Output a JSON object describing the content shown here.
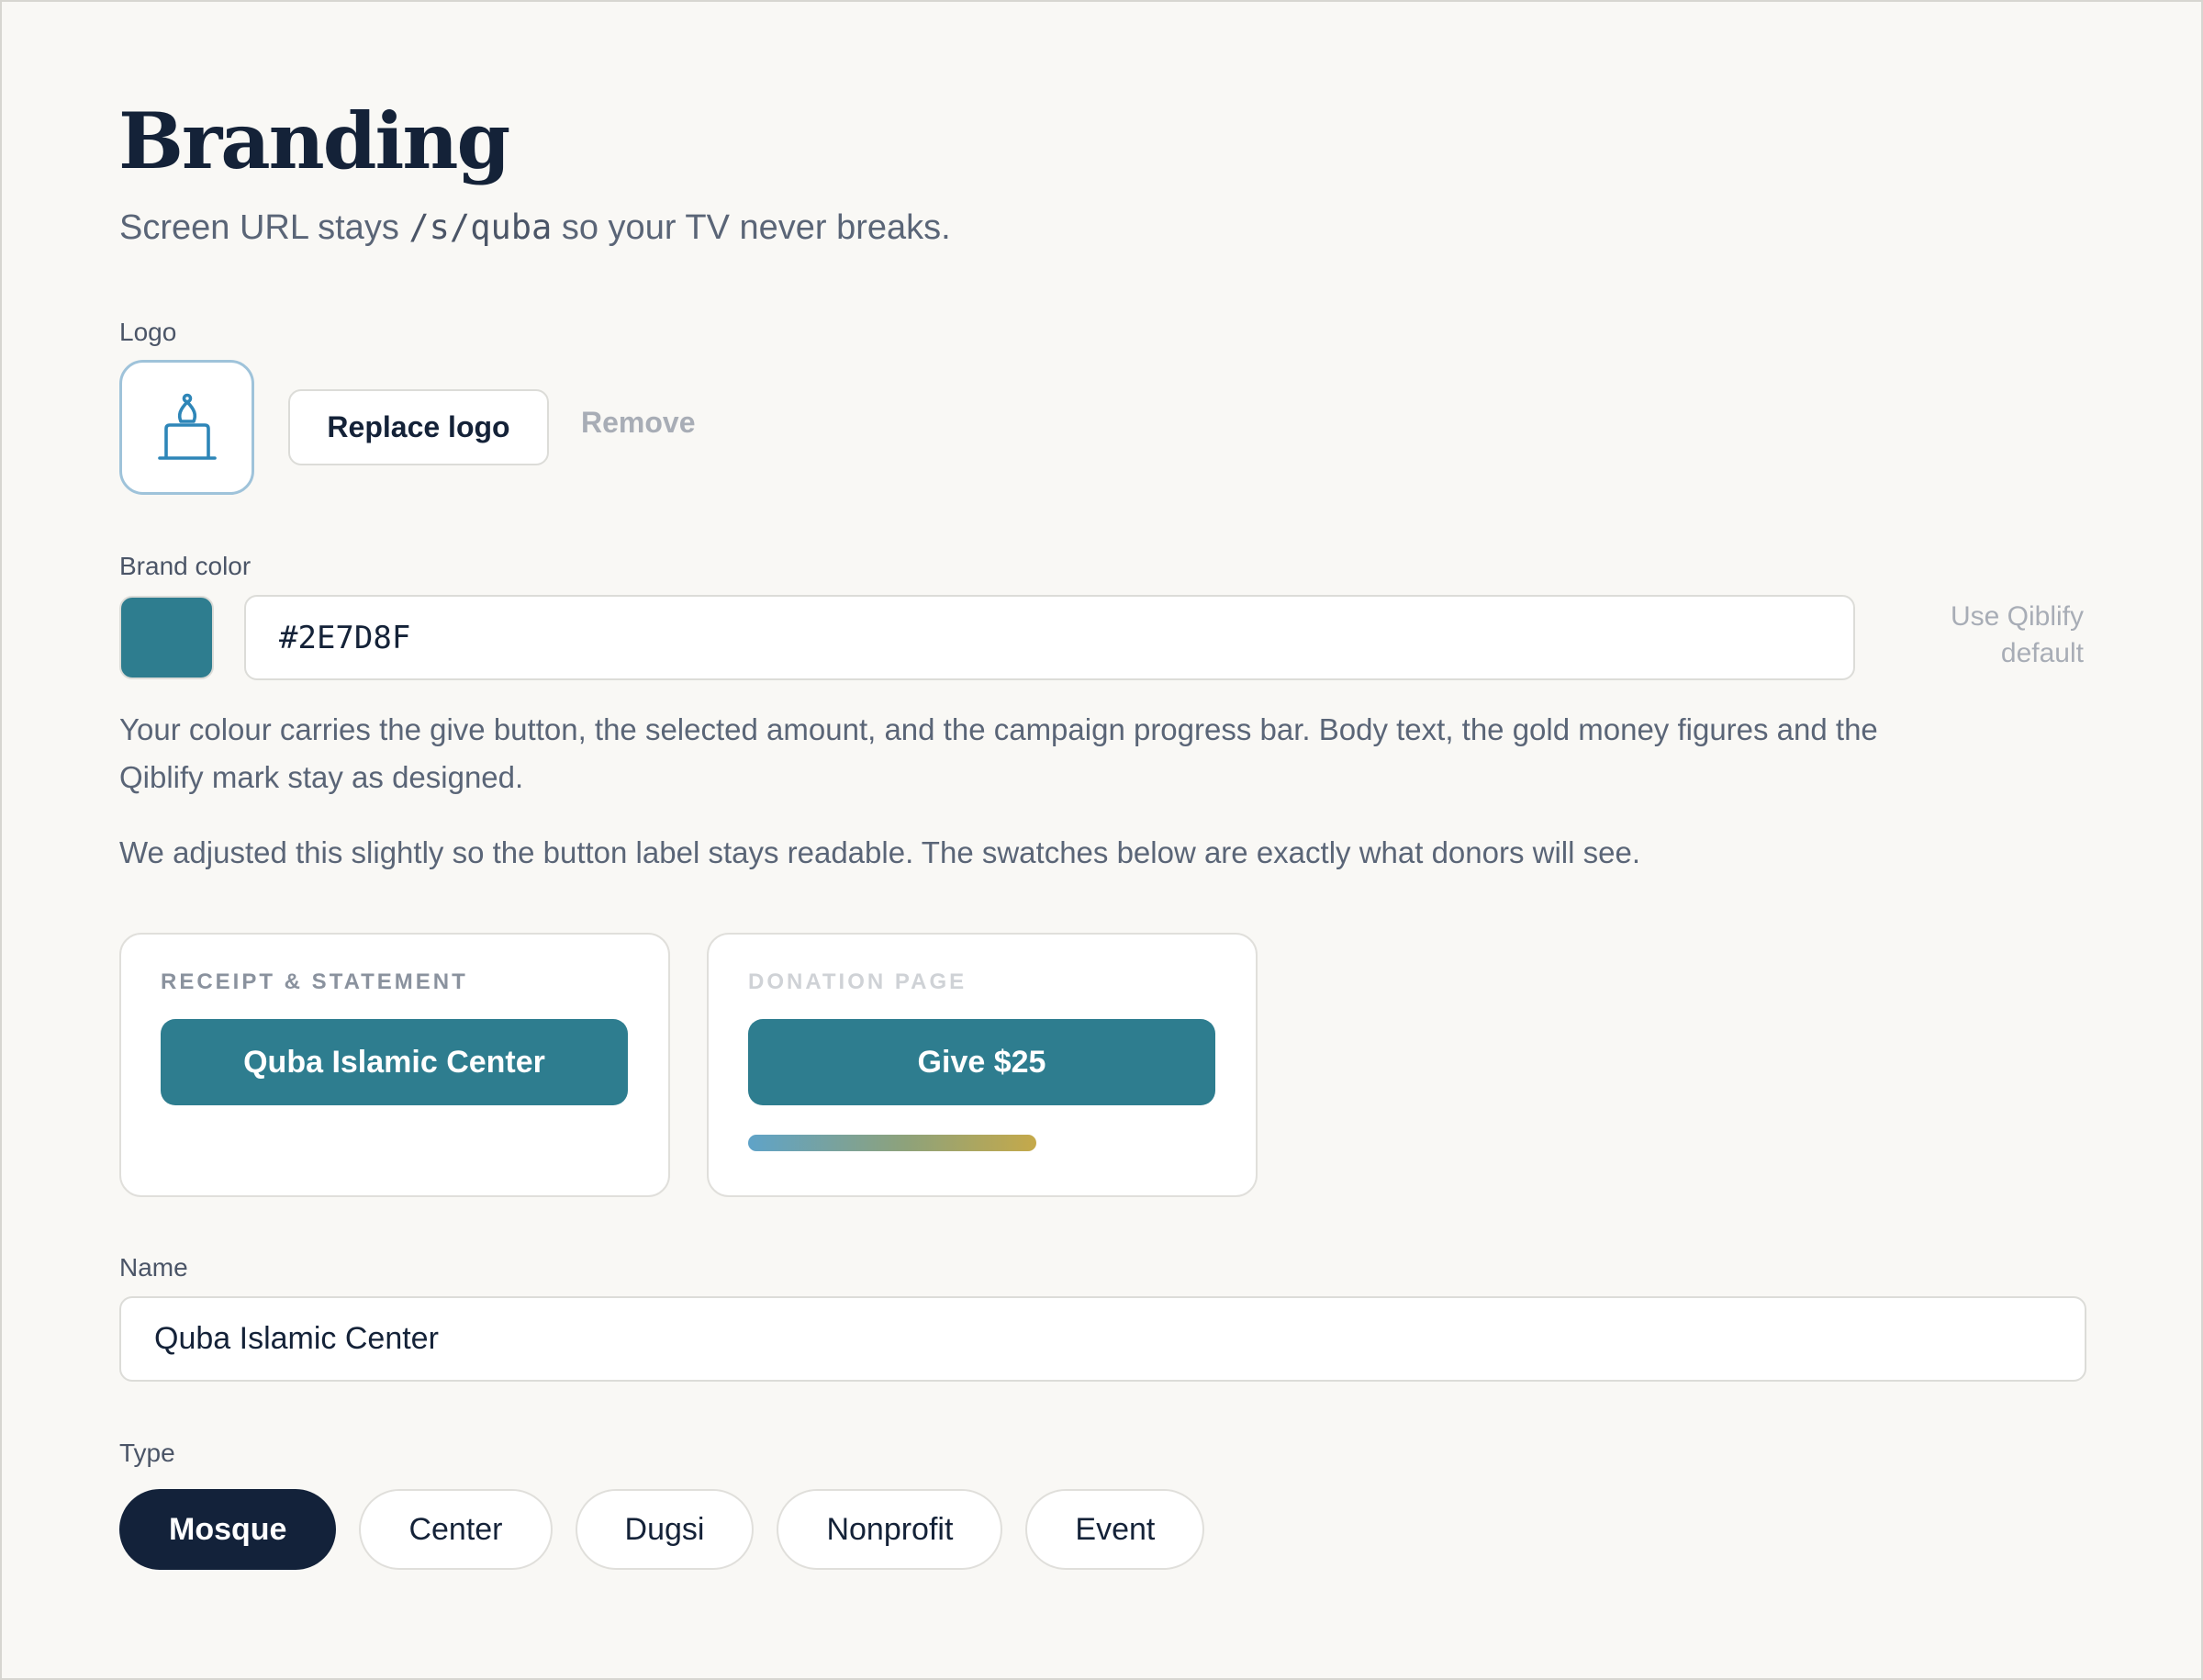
{
  "header": {
    "title": "Branding",
    "subtitle_before": "Screen URL stays ",
    "subtitle_code": "/s/quba",
    "subtitle_after": " so your TV never breaks."
  },
  "logo": {
    "label": "Logo",
    "icon": "mosque-dome-icon",
    "replace_label": "Replace logo",
    "remove_label": "Remove"
  },
  "brand_color": {
    "label": "Brand color",
    "value": "#2E7D8F",
    "swatch_color": "#2E7D8F",
    "default_link": "Use Qiblify default",
    "help_text": "Your colour carries the give button, the selected amount, and the campaign progress bar. Body text, the gold money figures and the Qiblify mark stay as designed.",
    "adjust_note": "We adjusted this slightly so the button label stays readable. The swatches below are exactly what donors will see."
  },
  "previews": [
    {
      "label": "RECEIPT & STATEMENT",
      "label_color": "#8a929e",
      "button": "Quba Islamic Center"
    },
    {
      "label": "DONATION PAGE",
      "label_color": "#cfd2d6",
      "button": "Give $25"
    }
  ],
  "name": {
    "label": "Name",
    "value": "Quba Islamic Center"
  },
  "type": {
    "label": "Type",
    "options": [
      "Mosque",
      "Center",
      "Dugsi",
      "Nonprofit",
      "Event"
    ],
    "selected": "Mosque"
  }
}
